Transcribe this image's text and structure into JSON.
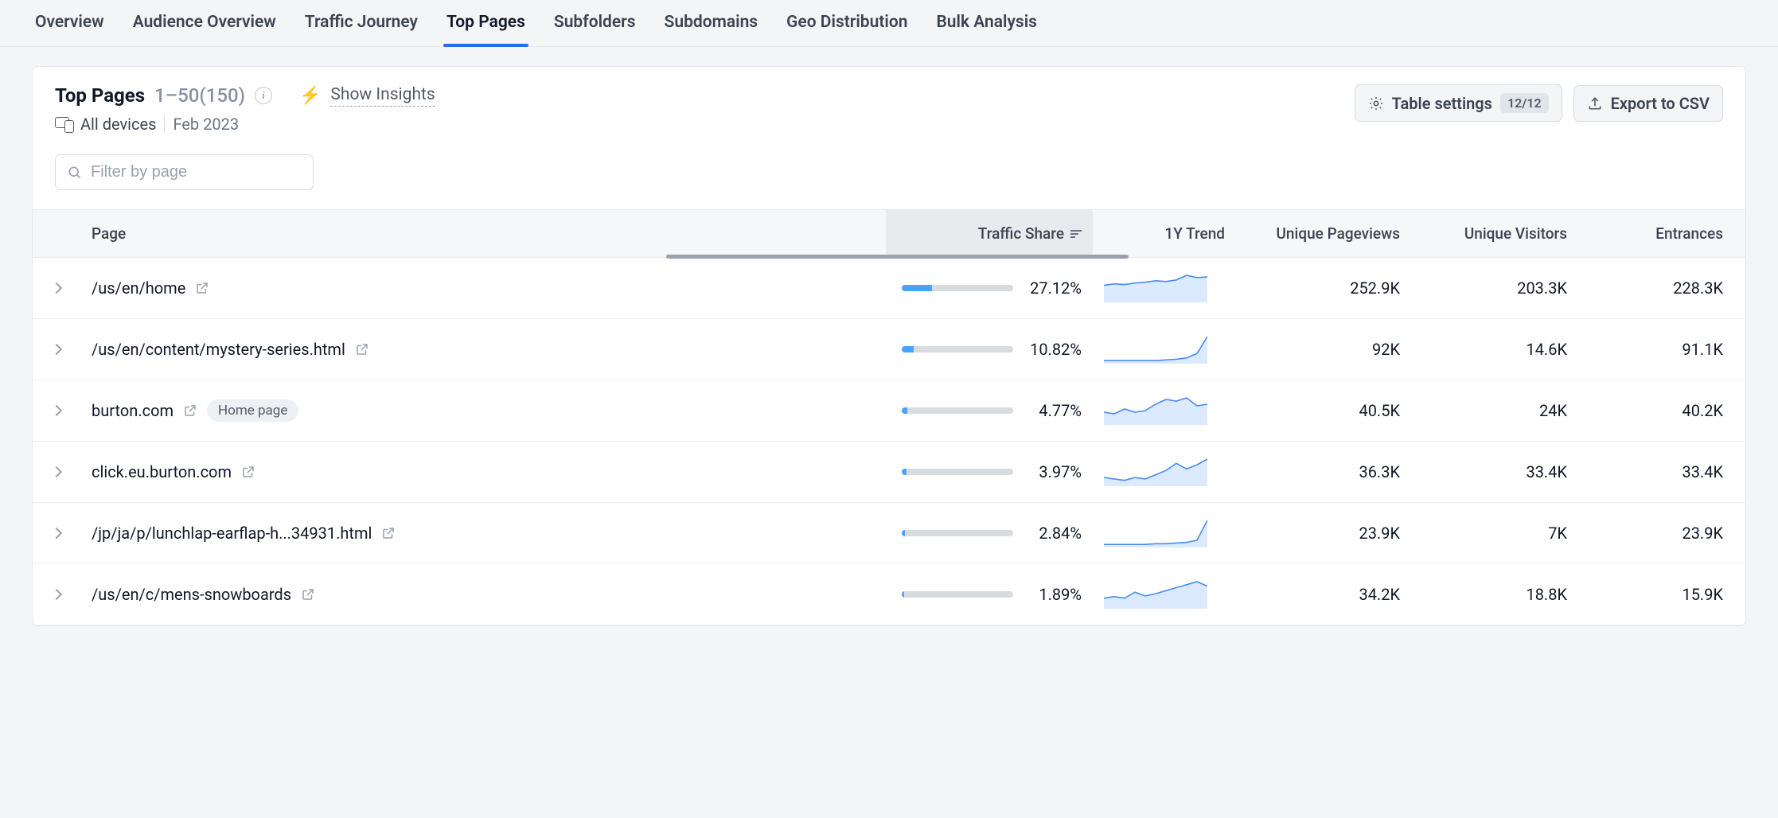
{
  "tabs": {
    "items": [
      {
        "label": "Overview",
        "active": false
      },
      {
        "label": "Audience Overview",
        "active": false
      },
      {
        "label": "Traffic Journey",
        "active": false
      },
      {
        "label": "Top Pages",
        "active": true
      },
      {
        "label": "Subfolders",
        "active": false
      },
      {
        "label": "Subdomains",
        "active": false
      },
      {
        "label": "Geo Distribution",
        "active": false
      },
      {
        "label": "Bulk Analysis",
        "active": false
      }
    ]
  },
  "header": {
    "title": "Top Pages",
    "range": "1–50(150)",
    "show_insights": "Show Insights",
    "devices": "All devices",
    "period": "Feb 2023",
    "table_settings_label": "Table settings",
    "table_settings_badge": "12/12",
    "export_label": "Export to CSV"
  },
  "filter": {
    "placeholder": "Filter by page"
  },
  "columns": {
    "page": "Page",
    "traffic_share": "Traffic Share",
    "trend": "1Y Trend",
    "unique_pageviews": "Unique Pageviews",
    "unique_visitors": "Unique Visitors",
    "entrances": "Entrances"
  },
  "rows": [
    {
      "page": "/us/en/home",
      "badge": null,
      "traffic_share": "27.12%",
      "share_pct": 27.12,
      "spark": [
        20,
        22,
        21,
        23,
        24,
        26,
        25,
        27,
        33,
        30,
        31
      ],
      "unique_pageviews": "252.9K",
      "unique_visitors": "203.3K",
      "entrances": "228.3K"
    },
    {
      "page": "/us/en/content/mystery-series.html",
      "badge": null,
      "traffic_share": "10.82%",
      "share_pct": 10.82,
      "spark": [
        2,
        2,
        2,
        2,
        2,
        2,
        3,
        4,
        6,
        12,
        36
      ],
      "unique_pageviews": "92K",
      "unique_visitors": "14.6K",
      "entrances": "91.1K"
    },
    {
      "page": "burton.com",
      "badge": "Home page",
      "traffic_share": "4.77%",
      "share_pct": 4.77,
      "spark": [
        14,
        12,
        18,
        14,
        16,
        24,
        30,
        28,
        32,
        22,
        24
      ],
      "unique_pageviews": "40.5K",
      "unique_visitors": "24K",
      "entrances": "40.2K"
    },
    {
      "page": "click.eu.burton.com",
      "badge": null,
      "traffic_share": "3.97%",
      "share_pct": 3.97,
      "spark": [
        10,
        8,
        6,
        10,
        8,
        14,
        20,
        30,
        22,
        28,
        36
      ],
      "unique_pageviews": "36.3K",
      "unique_visitors": "33.4K",
      "entrances": "33.4K"
    },
    {
      "page": "/jp/ja/p/lunchlap-earflap-h...34931.html",
      "badge": null,
      "traffic_share": "2.84%",
      "share_pct": 2.84,
      "spark": [
        2,
        2,
        2,
        2,
        2,
        3,
        3,
        4,
        5,
        8,
        36
      ],
      "unique_pageviews": "23.9K",
      "unique_visitors": "7K",
      "entrances": "23.9K"
    },
    {
      "page": "/us/en/c/mens-snowboards",
      "badge": null,
      "traffic_share": "1.89%",
      "share_pct": 1.89,
      "spark": [
        12,
        14,
        12,
        20,
        15,
        18,
        22,
        26,
        30,
        34,
        28
      ],
      "unique_pageviews": "34.2K",
      "unique_visitors": "18.8K",
      "entrances": "15.9K"
    }
  ]
}
